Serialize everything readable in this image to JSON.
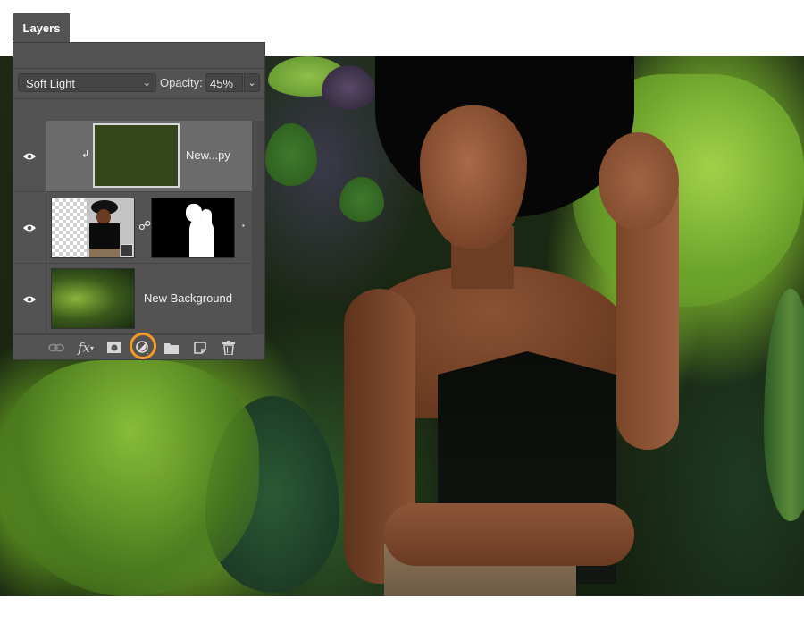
{
  "panel": {
    "tab_label": "Layers",
    "blend_mode": "Soft Light",
    "opacity_label": "Opacity:",
    "opacity_value": "45%"
  },
  "layers": [
    {
      "name": "New...py",
      "visible": true,
      "selected": true,
      "type": "color-fill",
      "fill_color": "#34461a",
      "clipped": true
    },
    {
      "name": "",
      "visible": true,
      "selected": false,
      "type": "smart-object-with-mask",
      "linked_mask": true
    },
    {
      "name": "New Background",
      "visible": true,
      "selected": false,
      "type": "image"
    }
  ],
  "footer_icons": [
    {
      "name": "link-layers-icon",
      "glyph": "⊖"
    },
    {
      "name": "layer-style-icon",
      "glyph": "fx"
    },
    {
      "name": "add-mask-icon",
      "glyph": "◉"
    },
    {
      "name": "adjustment-layer-icon",
      "glyph": "◐",
      "highlighted": true
    },
    {
      "name": "new-group-icon",
      "glyph": "▬"
    },
    {
      "name": "new-layer-icon",
      "glyph": "◱"
    },
    {
      "name": "delete-layer-icon",
      "glyph": "🗑"
    }
  ],
  "colors": {
    "highlight": "#f59b23",
    "panel_bg": "#535353",
    "selected_row": "#6b6b6b"
  }
}
